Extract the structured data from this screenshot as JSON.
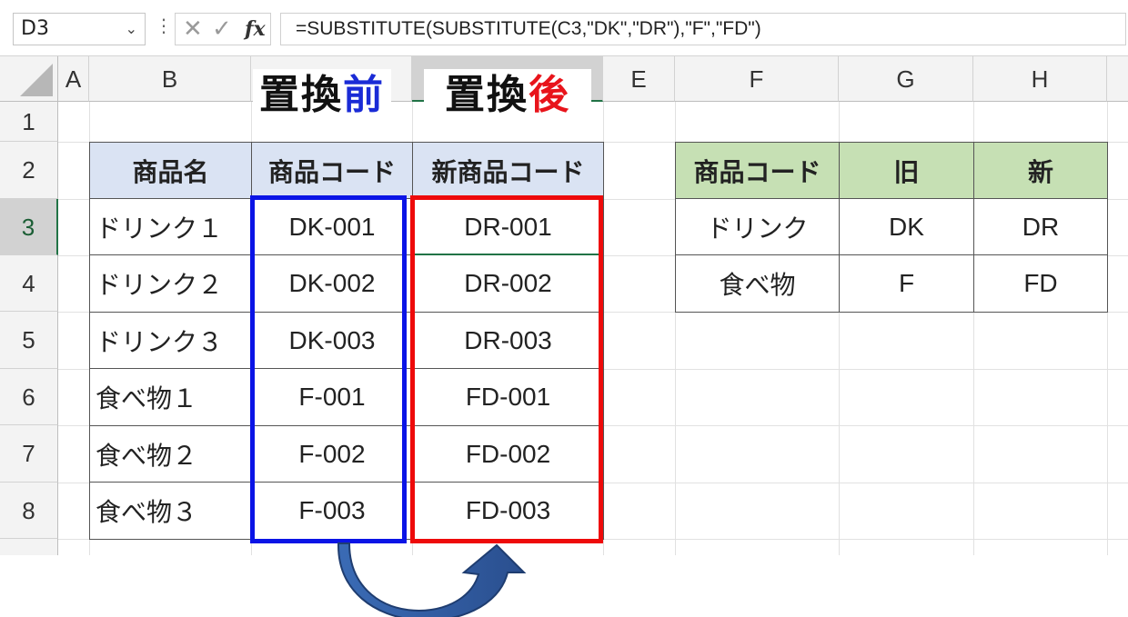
{
  "formula_bar": {
    "name_box": "D3",
    "formula": "=SUBSTITUTE(SUBSTITUTE(C3,\"DK\",\"DR\"),\"F\",\"FD\")",
    "icons": [
      "cancel-icon",
      "enter-check-icon",
      "fx-icon"
    ],
    "fx_label": "fx"
  },
  "columns": [
    "A",
    "B",
    "C",
    "D",
    "E",
    "F",
    "G",
    "H"
  ],
  "rows": [
    "1",
    "2",
    "3",
    "4",
    "5",
    "6",
    "7",
    "8"
  ],
  "banners": {
    "before_main": "置換",
    "before_accent": "前",
    "after_main": "置換",
    "after_accent": "後",
    "before_accent_color": "#1a2bd6",
    "after_accent_color": "#e8141b"
  },
  "main_table": {
    "headers": [
      "商品名",
      "商品コード",
      "新商品コード"
    ],
    "rows": [
      [
        "ドリンク１",
        "DK-001",
        "DR-001"
      ],
      [
        "ドリンク２",
        "DK-002",
        "DR-002"
      ],
      [
        "ドリンク３",
        "DK-003",
        "DR-003"
      ],
      [
        "食べ物１",
        "F-001",
        "FD-001"
      ],
      [
        "食べ物２",
        "F-002",
        "FD-002"
      ],
      [
        "食べ物３",
        "F-003",
        "FD-003"
      ]
    ]
  },
  "lookup_table": {
    "headers": [
      "商品コード",
      "旧",
      "新"
    ],
    "rows": [
      [
        "ドリンク",
        "DK",
        "DR"
      ],
      [
        "食べ物",
        "F",
        "FD"
      ]
    ]
  },
  "colors": {
    "header_blue": "#dae3f3",
    "header_green": "#c6e0b4",
    "before_box": "#0a14e6",
    "after_box": "#ee0a0a",
    "excel_green": "#217346",
    "arrow": "#2f5597"
  }
}
